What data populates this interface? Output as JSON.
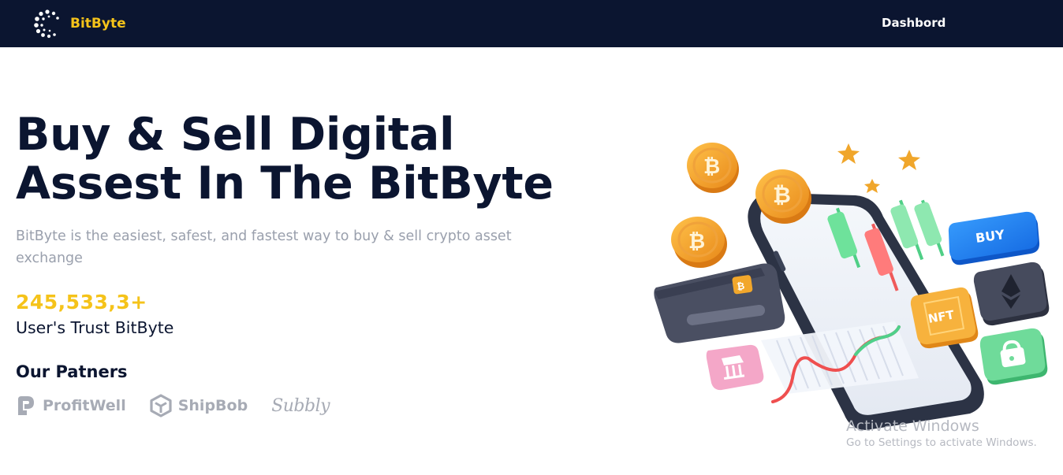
{
  "header": {
    "brand_name": "BitByte",
    "nav_link": "Dashbord"
  },
  "hero": {
    "title_line1": "Buy & Sell Digital",
    "title_line2": "Assest In The BitByte",
    "description": "BitByte is the easiest, safest, and fastest way to buy & sell crypto asset exchange",
    "stat_value": "245,533,3+",
    "stat_label": "User's Trust BitByte",
    "partners_title": "Our Patners",
    "partners": [
      "ProfitWell",
      "ShipBob",
      "Subbly"
    ]
  },
  "illustration": {
    "buy_label": "BUY",
    "nft_label": "NFT",
    "icons": [
      "bitcoin-coin-icon",
      "star-icon",
      "ethereum-icon",
      "lock-icon",
      "bank-icon",
      "credit-card-icon"
    ]
  },
  "watermark": {
    "title": "Activate Windows",
    "subtitle": "Go to Settings to activate Windows."
  },
  "colors": {
    "navbar": "#0b1530",
    "accent": "#f5c31a",
    "heading": "#0b1530",
    "muted": "#9aa0ad"
  }
}
